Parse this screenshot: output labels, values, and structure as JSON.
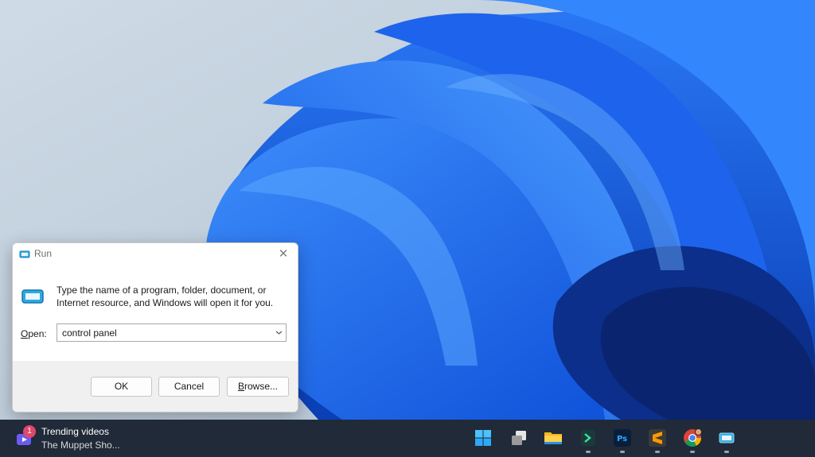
{
  "run_dialog": {
    "title": "Run",
    "close_glyph": "✕",
    "description_line1": "Type the name of a program, folder, document, or",
    "description_line2": "Internet resource, and Windows will open it for you.",
    "open_label_accel": "O",
    "open_label_rest": "pen:",
    "open_value": "control panel",
    "ok_label": "OK",
    "cancel_label": "Cancel",
    "browse_label_accel": "B",
    "browse_label_rest": "rowse..."
  },
  "taskbar": {
    "widget_badge": "1",
    "widget_title": "Trending videos",
    "widget_subtitle": "The Muppet Sho...",
    "apps": [
      {
        "icon": "windows-start-icon"
      },
      {
        "icon": "task-view-icon"
      },
      {
        "icon": "file-explorer-icon"
      },
      {
        "icon": "terminal-app-icon"
      },
      {
        "icon": "photoshop-icon"
      },
      {
        "icon": "sublime-text-icon"
      },
      {
        "icon": "chrome-icon"
      },
      {
        "icon": "run-app-icon"
      }
    ]
  },
  "colors": {
    "taskbar_bg": "#202a38",
    "wallpaper_blue": "#1565e8",
    "badge": "#e0476c"
  }
}
